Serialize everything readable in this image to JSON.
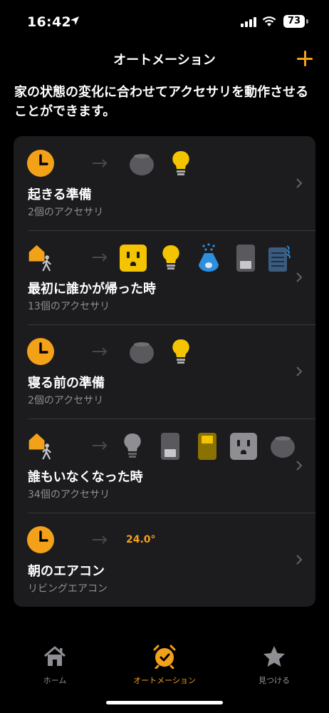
{
  "status_bar": {
    "time": "16:42",
    "battery": "73"
  },
  "nav": {
    "title": "オートメーション"
  },
  "description": "家の状態の変化に合わせてアクセサリを動作させることができます。",
  "automations": [
    {
      "title": "起きる準備",
      "subtitle": "2個のアクセサリ",
      "trigger": "clock-icon"
    },
    {
      "title": "最初に誰かが帰った時",
      "subtitle": "13個のアクセサリ",
      "trigger": "arrive-home-icon"
    },
    {
      "title": "寝る前の準備",
      "subtitle": "2個のアクセサリ",
      "trigger": "clock-icon"
    },
    {
      "title": "誰もいなくなった時",
      "subtitle": "34個のアクセサリ",
      "trigger": "leave-home-icon"
    },
    {
      "title": "朝のエアコン",
      "subtitle": "リビングエアコン",
      "trigger": "clock-icon",
      "setting": "24.0°"
    }
  ],
  "tabs": [
    {
      "label": "ホーム",
      "icon": "house-icon"
    },
    {
      "label": "オートメーション",
      "icon": "alarm-clock-icon",
      "active": true
    },
    {
      "label": "見つける",
      "icon": "star-icon"
    }
  ],
  "colors": {
    "accent": "#f4a11a",
    "card": "#1c1c1e",
    "secondary_text": "#8e8e93"
  }
}
